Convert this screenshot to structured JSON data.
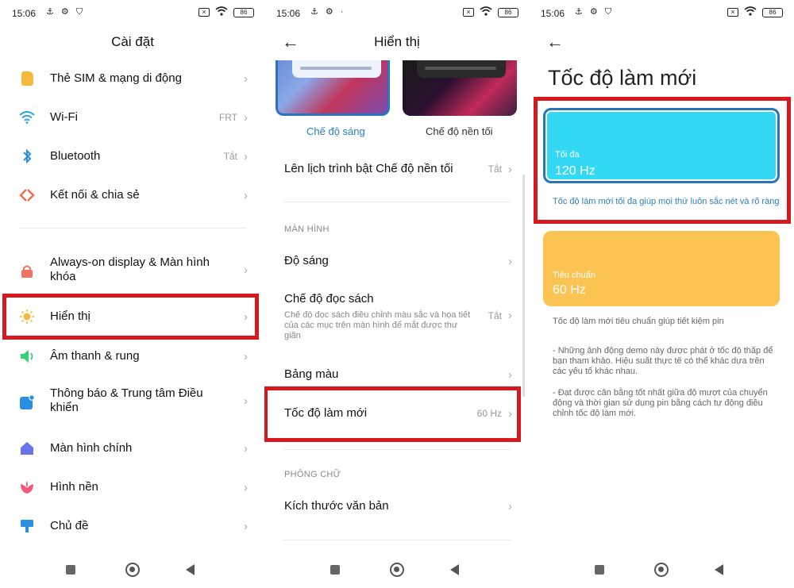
{
  "status": {
    "time": "15:06",
    "battery": "86"
  },
  "panel1": {
    "title": "Cài đặt",
    "items": [
      {
        "label": "Thẻ SIM & mạng di động",
        "value": "",
        "icon": "sim-icon",
        "color": "#f6b93b"
      },
      {
        "label": "Wi-Fi",
        "value": "FRT",
        "icon": "wifi-icon",
        "color": "#2aa3e0"
      },
      {
        "label": "Bluetooth",
        "value": "Tắt",
        "icon": "bluetooth-icon",
        "color": "#2a8fe0"
      },
      {
        "label": "Kết nối & chia sẻ",
        "value": "",
        "icon": "share-icon",
        "color": "#ef6b4a"
      },
      {
        "label": "Always-on display & Màn hình",
        "label2": "khóa",
        "value": "",
        "icon": "lock-icon",
        "color": "#f07264"
      },
      {
        "label": "Hiển thị",
        "value": "",
        "icon": "sun-icon",
        "color": "#f6b93b"
      },
      {
        "label": "Âm thanh & rung",
        "value": "",
        "icon": "speaker-icon",
        "color": "#3ccf7a"
      },
      {
        "label": "Thông báo & Trung tâm Điều",
        "label2": "khiển",
        "value": "",
        "icon": "notification-icon",
        "color": "#2a8fe0"
      },
      {
        "label": "Màn hình chính",
        "value": "",
        "icon": "home-icon",
        "color": "#6a73e8"
      },
      {
        "label": "Hình nền",
        "value": "",
        "icon": "flower-icon",
        "color": "#f0597a"
      },
      {
        "label": "Chủ đề",
        "value": "",
        "icon": "theme-icon",
        "color": "#2a8fe0"
      }
    ]
  },
  "panel2": {
    "title": "Hiển thị",
    "mode_light": "Chế độ sáng",
    "mode_dark": "Chế độ nền tối",
    "schedule_label": "Lên lịch trình bật Chế độ nền tối",
    "schedule_value": "Tắt",
    "section_screen": "MÀN HÌNH",
    "brightness": "Độ sáng",
    "reading_label": "Chế độ đọc sách",
    "reading_sub": "Chế độ đọc sách điều chỉnh màu sắc và họa tiết của các mục trên màn hình để mắt được thư giãn",
    "reading_value": "Tắt",
    "palette": "Bảng màu",
    "refresh_label": "Tốc độ làm mới",
    "refresh_value": "60 Hz",
    "section_font": "PHÔNG CHỮ",
    "text_size": "Kích thước văn bản"
  },
  "panel3": {
    "title": "Tốc độ làm mới",
    "max_key": "Tối đa",
    "max_val": "120 Hz",
    "max_desc": "Tốc độ làm mới tối đa giúp mọi thứ luôn sắc nét và rõ ràng",
    "std_key": "Tiêu chuẩn",
    "std_val": "60 Hz",
    "std_desc": "Tốc độ làm mới tiêu chuẩn giúp tiết kiệm pin",
    "note1": "- Những ảnh động demo này được phát ở tốc độ thấp để bạn tham khảo. Hiệu suất thực tế có thể khác dựa trên các yếu tố khác nhau.",
    "note2": "- Đạt được cân bằng tốt nhất giữa độ mượt của chuyển động và thời gian sử dụng pin bằng cách tự động điều chỉnh tốc độ làm mới."
  },
  "colors": {
    "highlight": "#d8181f",
    "max_card": "#33d9f4",
    "std_card": "#fbc452",
    "accent": "#2a7fc0"
  }
}
